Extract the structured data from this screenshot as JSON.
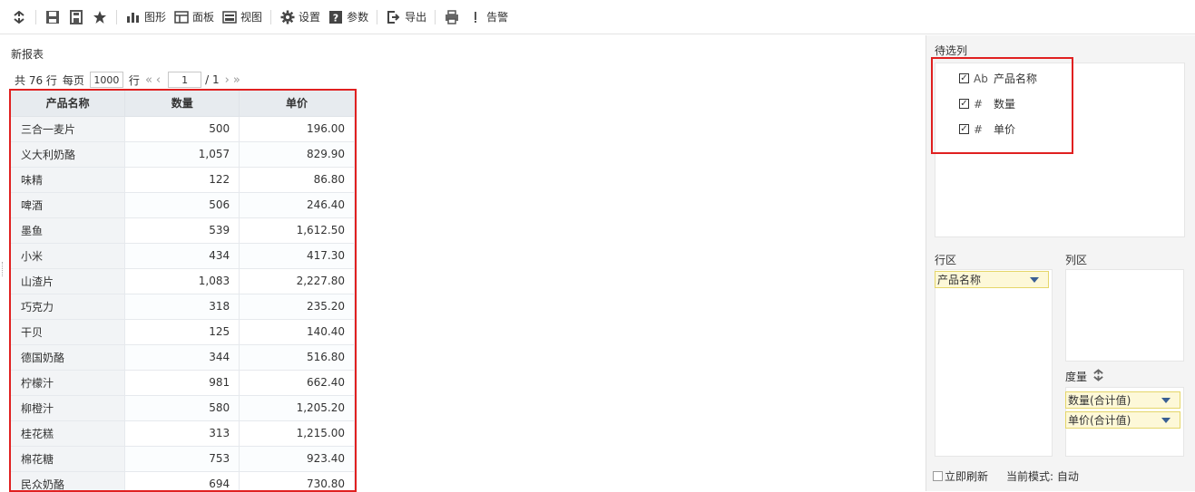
{
  "toolbar": {
    "items": [
      {
        "icon": "refresh-icon",
        "label": ""
      },
      {
        "icon": "save-icon",
        "label": ""
      },
      {
        "icon": "save-as-icon",
        "label": ""
      },
      {
        "icon": "star-icon",
        "label": ""
      },
      {
        "icon": "chart-icon",
        "label": "图形"
      },
      {
        "icon": "panel-icon",
        "label": "面板"
      },
      {
        "icon": "view-icon",
        "label": "视图"
      },
      {
        "icon": "gear-icon",
        "label": "设置"
      },
      {
        "icon": "help-icon",
        "label": "参数"
      },
      {
        "icon": "export-icon",
        "label": "导出"
      },
      {
        "icon": "print-icon",
        "label": ""
      },
      {
        "icon": "alert-icon",
        "label": "告警"
      }
    ]
  },
  "report": {
    "title": "新报表",
    "pager": {
      "total": "共 76 行",
      "per_page_label": "每页",
      "per_page_value": "1000",
      "row_unit": "行",
      "current_page": "1",
      "total_pages": "/ 1"
    },
    "columns": [
      "产品名称",
      "数量",
      "单价"
    ],
    "rows": [
      [
        "三合一麦片",
        "500",
        "196.00"
      ],
      [
        "义大利奶酪",
        "1,057",
        "829.90"
      ],
      [
        "味精",
        "122",
        "86.80"
      ],
      [
        "啤酒",
        "506",
        "246.40"
      ],
      [
        "墨鱼",
        "539",
        "1,612.50"
      ],
      [
        "小米",
        "434",
        "417.30"
      ],
      [
        "山渣片",
        "1,083",
        "2,227.80"
      ],
      [
        "巧克力",
        "318",
        "235.20"
      ],
      [
        "干贝",
        "125",
        "140.40"
      ],
      [
        "德国奶酪",
        "344",
        "516.80"
      ],
      [
        "柠檬汁",
        "981",
        "662.40"
      ],
      [
        "柳橙汁",
        "580",
        "1,205.20"
      ],
      [
        "桂花糕",
        "313",
        "1,215.00"
      ],
      [
        "棉花糖",
        "753",
        "923.40"
      ],
      [
        "民众奶酪",
        "694",
        "730.80"
      ]
    ]
  },
  "side": {
    "pending_label": "待选列",
    "fields": [
      {
        "type": "Ab",
        "name": "产品名称"
      },
      {
        "type": "#",
        "name": "数量"
      },
      {
        "type": "#",
        "name": "单价"
      }
    ],
    "row_area_label": "行区",
    "col_area_label": "列区",
    "row_tags": [
      "产品名称"
    ],
    "measure_label": "度量",
    "measures": [
      "数量(合计值)",
      "单价(合计值)"
    ],
    "auto_refresh_label": "立即刷新",
    "mode_label": "当前模式: 自动"
  }
}
